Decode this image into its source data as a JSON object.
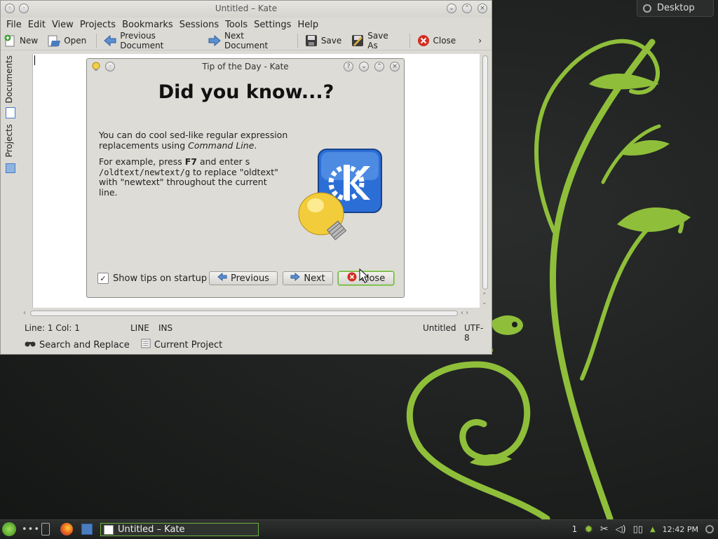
{
  "window": {
    "title": "Untitled – Kate",
    "menu": [
      "File",
      "Edit",
      "View",
      "Projects",
      "Bookmarks",
      "Sessions",
      "Tools",
      "Settings",
      "Help"
    ],
    "toolbar": {
      "new": "New",
      "open": "Open",
      "previous_document": "Previous Document",
      "next_document": "Next Document",
      "save": "Save",
      "save_as": "Save As",
      "close": "Close",
      "more": "›"
    },
    "sidebar": {
      "documents": "Documents",
      "projects": "Projects"
    },
    "status": {
      "position": "Line: 1 Col: 1",
      "mode_line": "LINE",
      "mode_ins": "INS",
      "doc_name": "Untitled",
      "encoding": "UTF-8"
    },
    "bottom_tabs": {
      "search": "Search and Replace",
      "project": "Current Project"
    }
  },
  "dialog": {
    "title": "Tip of the Day - Kate",
    "heading": "Did you know...?",
    "tip_p1_a": "You can do cool sed-like regular expression replacements using ",
    "tip_p1_em": "Command Line",
    "tip_p1_end": ".",
    "tip_p2_a": "For example, press ",
    "tip_p2_key": "F7",
    "tip_p2_b": " and enter s ",
    "tip_p2_code": "/oldtext/newtext/g",
    "tip_p2_c": " to replace \"oldtext\" with \"newtext\" throughout the current line.",
    "show_tips": "Show tips on startup",
    "show_tips_checked": true,
    "previous": "Previous",
    "next": "Next",
    "close": "Close"
  },
  "desktop": {
    "label": "Desktop"
  },
  "taskbar": {
    "task_title": "Untitled – Kate",
    "desktop_number": "1",
    "clock": "12:42 PM"
  },
  "colors": {
    "accent_green": "#6cb33f",
    "tb_bg": "#1d1f1e",
    "window_bg": "#dcdad5"
  }
}
